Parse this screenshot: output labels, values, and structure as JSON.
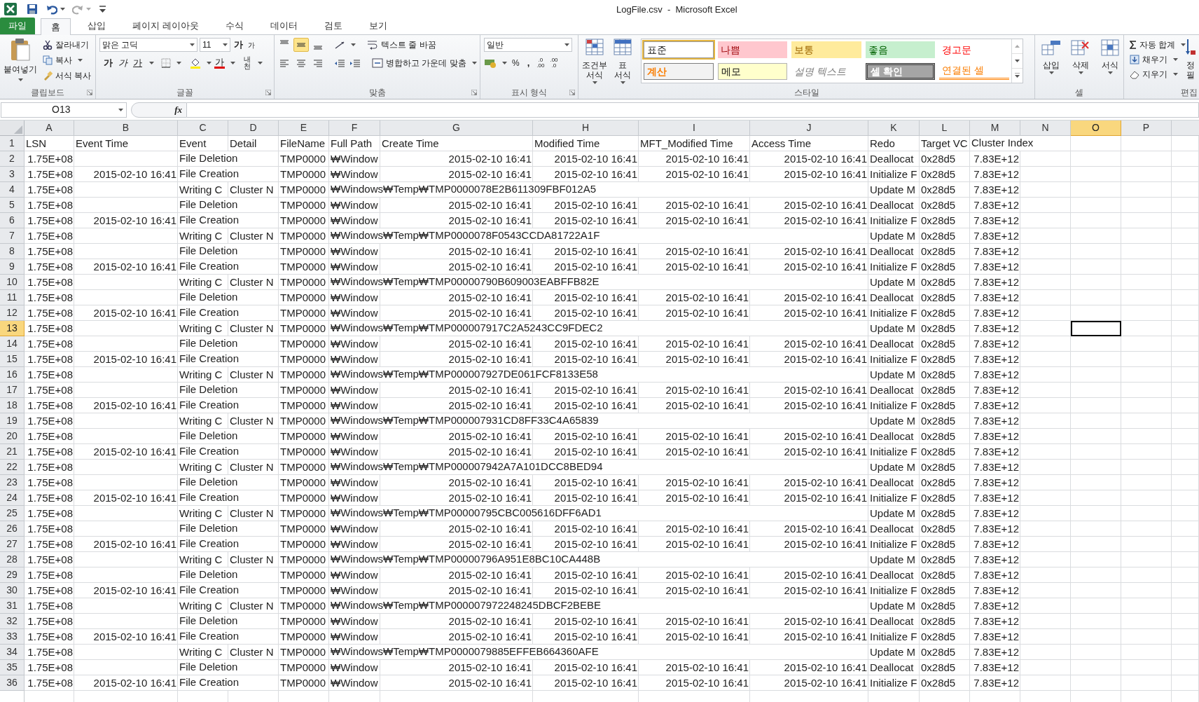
{
  "title": "LogFile.csv  -  Microsoft Excel",
  "tabs": [
    {
      "label": "파일",
      "kind": "file",
      "selected": false
    },
    {
      "label": "홈",
      "kind": "tab",
      "selected": true
    },
    {
      "label": "삽입",
      "kind": "tab",
      "selected": false
    },
    {
      "label": "페이지 레이아웃",
      "kind": "tab",
      "selected": false
    },
    {
      "label": "수식",
      "kind": "tab",
      "selected": false
    },
    {
      "label": "데이터",
      "kind": "tab",
      "selected": false
    },
    {
      "label": "검토",
      "kind": "tab",
      "selected": false
    },
    {
      "label": "보기",
      "kind": "tab",
      "selected": false
    }
  ],
  "clipboard": {
    "paste": "붙여넣기",
    "cut": "잘라내기",
    "copy": "복사",
    "format_painter": "서식 복사",
    "group": "클립보드"
  },
  "font": {
    "name": "맑은 고딕",
    "size": "11",
    "grow": "가",
    "shrink": "가",
    "bold": "가",
    "italic": "가",
    "underline": "가",
    "font_color": "가",
    "phonetic": "내천",
    "group": "글꼴"
  },
  "alignment": {
    "vertical": [
      {
        "kind": "top",
        "selected": false
      },
      {
        "kind": "middle",
        "selected": true
      },
      {
        "kind": "bottom",
        "selected": false
      }
    ],
    "wrap_text": "텍스트 줄 바꿈",
    "merge": "병합하고 가운데 맞춤",
    "group": "맞춤"
  },
  "number": {
    "format": "일반",
    "percent": "%",
    "comma": ",",
    "increase_decimal": [
      ".0",
      ".00"
    ],
    "decrease_decimal": [
      ".00",
      ".0"
    ],
    "group": "표시 형식"
  },
  "styles": {
    "conditional": [
      "조건부",
      "서식"
    ],
    "table": [
      "표",
      "서식"
    ],
    "group": "스타일",
    "gallery": [
      {
        "label": "표준",
        "kind": "normal",
        "selected": true
      },
      {
        "label": "나쁨",
        "kind": "bad",
        "selected": false
      },
      {
        "label": "보통",
        "kind": "neutral",
        "selected": false
      },
      {
        "label": "좋음",
        "kind": "good",
        "selected": false
      },
      {
        "label": "경고문",
        "kind": "warning",
        "selected": false
      },
      {
        "label": "계산",
        "kind": "calculation",
        "selected": false
      },
      {
        "label": "메모",
        "kind": "note",
        "selected": false
      },
      {
        "label": "설명 텍스트",
        "kind": "explanatory",
        "selected": false
      },
      {
        "label": "셀 확인",
        "kind": "check",
        "selected": false
      },
      {
        "label": "연결된 셀",
        "kind": "linked",
        "selected": false
      }
    ]
  },
  "cells": {
    "insert": "삽입",
    "delete": "삭제",
    "format": "서식",
    "group": "셀"
  },
  "editing": {
    "autosum": "자동 합계",
    "fill": "채우기",
    "clear": "지우기",
    "sort": [
      "정",
      "필"
    ],
    "group": "편집"
  },
  "formula_bar": {
    "name_box": "O13",
    "fx": "fx"
  },
  "columns": [
    {
      "letter": "A",
      "selected": false
    },
    {
      "letter": "B",
      "selected": false
    },
    {
      "letter": "C",
      "selected": false
    },
    {
      "letter": "D",
      "selected": false
    },
    {
      "letter": "E",
      "selected": false
    },
    {
      "letter": "F",
      "selected": false
    },
    {
      "letter": "G",
      "selected": false
    },
    {
      "letter": "H",
      "selected": false
    },
    {
      "letter": "I",
      "selected": false
    },
    {
      "letter": "J",
      "selected": false
    },
    {
      "letter": "K",
      "selected": false
    },
    {
      "letter": "L",
      "selected": false
    },
    {
      "letter": "M",
      "selected": false
    },
    {
      "letter": "N",
      "selected": false
    },
    {
      "letter": "O",
      "selected": true
    },
    {
      "letter": "P",
      "selected": false
    }
  ],
  "heading_row": {
    "number": "1",
    "selected": false,
    "labels": [
      "LSN",
      "Event Time",
      "Event",
      "Detail",
      "FileName",
      "Full Path",
      "Create Time",
      "Modified Time",
      "MFT_Modified Time",
      "Access Time",
      "Redo",
      "Target VC",
      "Cluster Index"
    ]
  },
  "rows": [
    {
      "number": "2",
      "kind": "data",
      "selected": false,
      "lsn": "1.75E+08",
      "event": "File Deletion",
      "filename": "TMP0000",
      "full_path": "₩Window",
      "create_time": "2015-02-10 16:41",
      "modified_time": "2015-02-10 16:41",
      "mft_modified_time": "2015-02-10 16:41",
      "access_time": "2015-02-10 16:41",
      "redo": "Deallocat",
      "target_vcn": "0x28d5",
      "cluster_index": "7.83E+12"
    },
    {
      "number": "3",
      "kind": "data",
      "selected": false,
      "lsn": "1.75E+08",
      "event_time": "2015-02-10 16:41",
      "event": "File Creation",
      "filename": "TMP0000",
      "full_path": "₩Window",
      "create_time": "2015-02-10 16:41",
      "modified_time": "2015-02-10 16:41",
      "mft_modified_time": "2015-02-10 16:41",
      "access_time": "2015-02-10 16:41",
      "redo": "Initialize F",
      "target_vcn": "0x28d5",
      "cluster_index": "7.83E+12"
    },
    {
      "number": "4",
      "kind": "data",
      "selected": false,
      "lsn": "1.75E+08",
      "event": "Writing C",
      "detail": "Cluster N",
      "filename": "TMP0000",
      "full_path": "₩Windows₩Temp₩TMP0000078E2B611309FBF012A5",
      "redo": "Update M",
      "target_vcn": "0x28d5",
      "cluster_index": "7.83E+12"
    },
    {
      "number": "5",
      "kind": "data",
      "selected": false,
      "lsn": "1.75E+08",
      "event": "File Deletion",
      "filename": "TMP0000",
      "full_path": "₩Window",
      "create_time": "2015-02-10 16:41",
      "modified_time": "2015-02-10 16:41",
      "mft_modified_time": "2015-02-10 16:41",
      "access_time": "2015-02-10 16:41",
      "redo": "Deallocat",
      "target_vcn": "0x28d5",
      "cluster_index": "7.83E+12"
    },
    {
      "number": "6",
      "kind": "data",
      "selected": false,
      "lsn": "1.75E+08",
      "event_time": "2015-02-10 16:41",
      "event": "File Creation",
      "filename": "TMP0000",
      "full_path": "₩Window",
      "create_time": "2015-02-10 16:41",
      "modified_time": "2015-02-10 16:41",
      "mft_modified_time": "2015-02-10 16:41",
      "access_time": "2015-02-10 16:41",
      "redo": "Initialize F",
      "target_vcn": "0x28d5",
      "cluster_index": "7.83E+12"
    },
    {
      "number": "7",
      "kind": "data",
      "selected": false,
      "lsn": "1.75E+08",
      "event": "Writing C",
      "detail": "Cluster N",
      "filename": "TMP0000",
      "full_path": "₩Windows₩Temp₩TMP0000078F0543CCDA81722A1F",
      "redo": "Update M",
      "target_vcn": "0x28d5",
      "cluster_index": "7.83E+12"
    },
    {
      "number": "8",
      "kind": "data",
      "selected": false,
      "lsn": "1.75E+08",
      "event": "File Deletion",
      "filename": "TMP0000",
      "full_path": "₩Window",
      "create_time": "2015-02-10 16:41",
      "modified_time": "2015-02-10 16:41",
      "mft_modified_time": "2015-02-10 16:41",
      "access_time": "2015-02-10 16:41",
      "redo": "Deallocat",
      "target_vcn": "0x28d5",
      "cluster_index": "7.83E+12"
    },
    {
      "number": "9",
      "kind": "data",
      "selected": false,
      "lsn": "1.75E+08",
      "event_time": "2015-02-10 16:41",
      "event": "File Creation",
      "filename": "TMP0000",
      "full_path": "₩Window",
      "create_time": "2015-02-10 16:41",
      "modified_time": "2015-02-10 16:41",
      "mft_modified_time": "2015-02-10 16:41",
      "access_time": "2015-02-10 16:41",
      "redo": "Initialize F",
      "target_vcn": "0x28d5",
      "cluster_index": "7.83E+12"
    },
    {
      "number": "10",
      "kind": "data",
      "selected": false,
      "lsn": "1.75E+08",
      "event": "Writing C",
      "detail": "Cluster N",
      "filename": "TMP0000",
      "full_path": "₩Windows₩Temp₩TMP00000790B609003EABFFB82E",
      "redo": "Update M",
      "target_vcn": "0x28d5",
      "cluster_index": "7.83E+12"
    },
    {
      "number": "11",
      "kind": "data",
      "selected": false,
      "lsn": "1.75E+08",
      "event": "File Deletion",
      "filename": "TMP0000",
      "full_path": "₩Window",
      "create_time": "2015-02-10 16:41",
      "modified_time": "2015-02-10 16:41",
      "mft_modified_time": "2015-02-10 16:41",
      "access_time": "2015-02-10 16:41",
      "redo": "Deallocat",
      "target_vcn": "0x28d5",
      "cluster_index": "7.83E+12"
    },
    {
      "number": "12",
      "kind": "data",
      "selected": false,
      "lsn": "1.75E+08",
      "event_time": "2015-02-10 16:41",
      "event": "File Creation",
      "filename": "TMP0000",
      "full_path": "₩Window",
      "create_time": "2015-02-10 16:41",
      "modified_time": "2015-02-10 16:41",
      "mft_modified_time": "2015-02-10 16:41",
      "access_time": "2015-02-10 16:41",
      "redo": "Initialize F",
      "target_vcn": "0x28d5",
      "cluster_index": "7.83E+12"
    },
    {
      "number": "13",
      "kind": "data",
      "selected": true,
      "lsn": "1.75E+08",
      "event": "Writing C",
      "detail": "Cluster N",
      "filename": "TMP0000",
      "full_path": "₩Windows₩Temp₩TMP000007917C2A5243CC9FDEC2",
      "redo": "Update M",
      "target_vcn": "0x28d5",
      "cluster_index": "7.83E+12"
    },
    {
      "number": "14",
      "kind": "data",
      "selected": false,
      "lsn": "1.75E+08",
      "event": "File Deletion",
      "filename": "TMP0000",
      "full_path": "₩Window",
      "create_time": "2015-02-10 16:41",
      "modified_time": "2015-02-10 16:41",
      "mft_modified_time": "2015-02-10 16:41",
      "access_time": "2015-02-10 16:41",
      "redo": "Deallocat",
      "target_vcn": "0x28d5",
      "cluster_index": "7.83E+12"
    },
    {
      "number": "15",
      "kind": "data",
      "selected": false,
      "lsn": "1.75E+08",
      "event_time": "2015-02-10 16:41",
      "event": "File Creation",
      "filename": "TMP0000",
      "full_path": "₩Window",
      "create_time": "2015-02-10 16:41",
      "modified_time": "2015-02-10 16:41",
      "mft_modified_time": "2015-02-10 16:41",
      "access_time": "2015-02-10 16:41",
      "redo": "Initialize F",
      "target_vcn": "0x28d5",
      "cluster_index": "7.83E+12"
    },
    {
      "number": "16",
      "kind": "data",
      "selected": false,
      "lsn": "1.75E+08",
      "event": "Writing C",
      "detail": "Cluster N",
      "filename": "TMP0000",
      "full_path": "₩Windows₩Temp₩TMP000007927DE061FCF8133E58",
      "redo": "Update M",
      "target_vcn": "0x28d5",
      "cluster_index": "7.83E+12"
    },
    {
      "number": "17",
      "kind": "data",
      "selected": false,
      "lsn": "1.75E+08",
      "event": "File Deletion",
      "filename": "TMP0000",
      "full_path": "₩Window",
      "create_time": "2015-02-10 16:41",
      "modified_time": "2015-02-10 16:41",
      "mft_modified_time": "2015-02-10 16:41",
      "access_time": "2015-02-10 16:41",
      "redo": "Deallocat",
      "target_vcn": "0x28d5",
      "cluster_index": "7.83E+12"
    },
    {
      "number": "18",
      "kind": "data",
      "selected": false,
      "lsn": "1.75E+08",
      "event_time": "2015-02-10 16:41",
      "event": "File Creation",
      "filename": "TMP0000",
      "full_path": "₩Window",
      "create_time": "2015-02-10 16:41",
      "modified_time": "2015-02-10 16:41",
      "mft_modified_time": "2015-02-10 16:41",
      "access_time": "2015-02-10 16:41",
      "redo": "Initialize F",
      "target_vcn": "0x28d5",
      "cluster_index": "7.83E+12"
    },
    {
      "number": "19",
      "kind": "data",
      "selected": false,
      "lsn": "1.75E+08",
      "event": "Writing C",
      "detail": "Cluster N",
      "filename": "TMP0000",
      "full_path": "₩Windows₩Temp₩TMP000007931CD8FF33C4A65839",
      "redo": "Update M",
      "target_vcn": "0x28d5",
      "cluster_index": "7.83E+12"
    },
    {
      "number": "20",
      "kind": "data",
      "selected": false,
      "lsn": "1.75E+08",
      "event": "File Deletion",
      "filename": "TMP0000",
      "full_path": "₩Window",
      "create_time": "2015-02-10 16:41",
      "modified_time": "2015-02-10 16:41",
      "mft_modified_time": "2015-02-10 16:41",
      "access_time": "2015-02-10 16:41",
      "redo": "Deallocat",
      "target_vcn": "0x28d5",
      "cluster_index": "7.83E+12"
    },
    {
      "number": "21",
      "kind": "data",
      "selected": false,
      "lsn": "1.75E+08",
      "event_time": "2015-02-10 16:41",
      "event": "File Creation",
      "filename": "TMP0000",
      "full_path": "₩Window",
      "create_time": "2015-02-10 16:41",
      "modified_time": "2015-02-10 16:41",
      "mft_modified_time": "2015-02-10 16:41",
      "access_time": "2015-02-10 16:41",
      "redo": "Initialize F",
      "target_vcn": "0x28d5",
      "cluster_index": "7.83E+12"
    },
    {
      "number": "22",
      "kind": "data",
      "selected": false,
      "lsn": "1.75E+08",
      "event": "Writing C",
      "detail": "Cluster N",
      "filename": "TMP0000",
      "full_path": "₩Windows₩Temp₩TMP000007942A7A101DCC8BED94",
      "redo": "Update M",
      "target_vcn": "0x28d5",
      "cluster_index": "7.83E+12"
    },
    {
      "number": "23",
      "kind": "data",
      "selected": false,
      "lsn": "1.75E+08",
      "event": "File Deletion",
      "filename": "TMP0000",
      "full_path": "₩Window",
      "create_time": "2015-02-10 16:41",
      "modified_time": "2015-02-10 16:41",
      "mft_modified_time": "2015-02-10 16:41",
      "access_time": "2015-02-10 16:41",
      "redo": "Deallocat",
      "target_vcn": "0x28d5",
      "cluster_index": "7.83E+12"
    },
    {
      "number": "24",
      "kind": "data",
      "selected": false,
      "lsn": "1.75E+08",
      "event_time": "2015-02-10 16:41",
      "event": "File Creation",
      "filename": "TMP0000",
      "full_path": "₩Window",
      "create_time": "2015-02-10 16:41",
      "modified_time": "2015-02-10 16:41",
      "mft_modified_time": "2015-02-10 16:41",
      "access_time": "2015-02-10 16:41",
      "redo": "Initialize F",
      "target_vcn": "0x28d5",
      "cluster_index": "7.83E+12"
    },
    {
      "number": "25",
      "kind": "data",
      "selected": false,
      "lsn": "1.75E+08",
      "event": "Writing C",
      "detail": "Cluster N",
      "filename": "TMP0000",
      "full_path": "₩Windows₩Temp₩TMP00000795CBC005616DFF6AD1",
      "redo": "Update M",
      "target_vcn": "0x28d5",
      "cluster_index": "7.83E+12"
    },
    {
      "number": "26",
      "kind": "data",
      "selected": false,
      "lsn": "1.75E+08",
      "event": "File Deletion",
      "filename": "TMP0000",
      "full_path": "₩Window",
      "create_time": "2015-02-10 16:41",
      "modified_time": "2015-02-10 16:41",
      "mft_modified_time": "2015-02-10 16:41",
      "access_time": "2015-02-10 16:41",
      "redo": "Deallocat",
      "target_vcn": "0x28d5",
      "cluster_index": "7.83E+12"
    },
    {
      "number": "27",
      "kind": "data",
      "selected": false,
      "lsn": "1.75E+08",
      "event_time": "2015-02-10 16:41",
      "event": "File Creation",
      "filename": "TMP0000",
      "full_path": "₩Window",
      "create_time": "2015-02-10 16:41",
      "modified_time": "2015-02-10 16:41",
      "mft_modified_time": "2015-02-10 16:41",
      "access_time": "2015-02-10 16:41",
      "redo": "Initialize F",
      "target_vcn": "0x28d5",
      "cluster_index": "7.83E+12"
    },
    {
      "number": "28",
      "kind": "data",
      "selected": false,
      "lsn": "1.75E+08",
      "event": "Writing C",
      "detail": "Cluster N",
      "filename": "TMP0000",
      "full_path": "₩Windows₩Temp₩TMP00000796A951E8BC10CA448B",
      "redo": "Update M",
      "target_vcn": "0x28d5",
      "cluster_index": "7.83E+12"
    },
    {
      "number": "29",
      "kind": "data",
      "selected": false,
      "lsn": "1.75E+08",
      "event": "File Deletion",
      "filename": "TMP0000",
      "full_path": "₩Window",
      "create_time": "2015-02-10 16:41",
      "modified_time": "2015-02-10 16:41",
      "mft_modified_time": "2015-02-10 16:41",
      "access_time": "2015-02-10 16:41",
      "redo": "Deallocat",
      "target_vcn": "0x28d5",
      "cluster_index": "7.83E+12"
    },
    {
      "number": "30",
      "kind": "data",
      "selected": false,
      "lsn": "1.75E+08",
      "event_time": "2015-02-10 16:41",
      "event": "File Creation",
      "filename": "TMP0000",
      "full_path": "₩Window",
      "create_time": "2015-02-10 16:41",
      "modified_time": "2015-02-10 16:41",
      "mft_modified_time": "2015-02-10 16:41",
      "access_time": "2015-02-10 16:41",
      "redo": "Initialize F",
      "target_vcn": "0x28d5",
      "cluster_index": "7.83E+12"
    },
    {
      "number": "31",
      "kind": "data",
      "selected": false,
      "lsn": "1.75E+08",
      "event": "Writing C",
      "detail": "Cluster N",
      "filename": "TMP0000",
      "full_path": "₩Windows₩Temp₩TMP000007972248245DBCF2BEBE",
      "redo": "Update M",
      "target_vcn": "0x28d5",
      "cluster_index": "7.83E+12"
    },
    {
      "number": "32",
      "kind": "data",
      "selected": false,
      "lsn": "1.75E+08",
      "event": "File Deletion",
      "filename": "TMP0000",
      "full_path": "₩Window",
      "create_time": "2015-02-10 16:41",
      "modified_time": "2015-02-10 16:41",
      "mft_modified_time": "2015-02-10 16:41",
      "access_time": "2015-02-10 16:41",
      "redo": "Deallocat",
      "target_vcn": "0x28d5",
      "cluster_index": "7.83E+12"
    },
    {
      "number": "33",
      "kind": "data",
      "selected": false,
      "lsn": "1.75E+08",
      "event_time": "2015-02-10 16:41",
      "event": "File Creation",
      "filename": "TMP0000",
      "full_path": "₩Window",
      "create_time": "2015-02-10 16:41",
      "modified_time": "2015-02-10 16:41",
      "mft_modified_time": "2015-02-10 16:41",
      "access_time": "2015-02-10 16:41",
      "redo": "Initialize F",
      "target_vcn": "0x28d5",
      "cluster_index": "7.83E+12"
    },
    {
      "number": "34",
      "kind": "data",
      "selected": false,
      "lsn": "1.75E+08",
      "event": "Writing C",
      "detail": "Cluster N",
      "filename": "TMP0000",
      "full_path": "₩Windows₩Temp₩TMP0000079885EFFEB664360AFE",
      "redo": "Update M",
      "target_vcn": "0x28d5",
      "cluster_index": "7.83E+12"
    },
    {
      "number": "35",
      "kind": "data",
      "selected": false,
      "lsn": "1.75E+08",
      "event": "File Deletion",
      "filename": "TMP0000",
      "full_path": "₩Window",
      "create_time": "2015-02-10 16:41",
      "modified_time": "2015-02-10 16:41",
      "mft_modified_time": "2015-02-10 16:41",
      "access_time": "2015-02-10 16:41",
      "redo": "Deallocat",
      "target_vcn": "0x28d5",
      "cluster_index": "7.83E+12"
    },
    {
      "number": "36",
      "kind": "data",
      "selected": false,
      "lsn": "1.75E+08",
      "event_time": "2015-02-10 16:41",
      "event": "File Creation",
      "filename": "TMP0000",
      "full_path": "₩Window",
      "create_time": "2015-02-10 16:41",
      "modified_time": "2015-02-10 16:41",
      "mft_modified_time": "2015-02-10 16:41",
      "access_time": "2015-02-10 16:41",
      "redo": "Initialize F",
      "target_vcn": "0x28d5",
      "cluster_index": "7.83E+12"
    }
  ]
}
